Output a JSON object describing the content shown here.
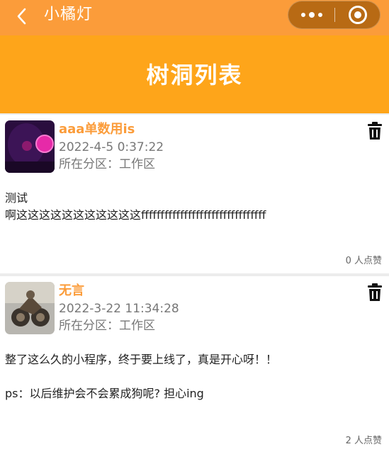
{
  "navbar": {
    "title": "小橘灯",
    "back_icon": "chevron-left-icon",
    "more_icon": "more-dots-icon",
    "close_icon": "target-circle-icon"
  },
  "header": {
    "title": "树洞列表"
  },
  "colors": {
    "navbar": "#fb9c3a",
    "header": "#fea51a",
    "author": "#fb9c3a",
    "capsule": "#b86a14"
  },
  "posts": [
    {
      "author": "aaa单数用is",
      "time": "2022-4-5 0:37:22",
      "zone": "所在分区：工作区",
      "content_lines": [
        "测试",
        "啊这这这这这这这这这这这ffffffffffffffffffffffffffffffff"
      ],
      "likes": "0 人点赞",
      "delete_icon": "trash-icon"
    },
    {
      "author": "无言",
      "time": "2022-3-22 11:34:28",
      "zone": "所在分区：工作区",
      "content_lines": [
        "整了这么久的小程序，终于要上线了，真是开心呀！！",
        "",
        "ps：以后维护会不会累成狗呢? 担心ing"
      ],
      "likes": "2 人点赞",
      "delete_icon": "trash-icon"
    }
  ]
}
